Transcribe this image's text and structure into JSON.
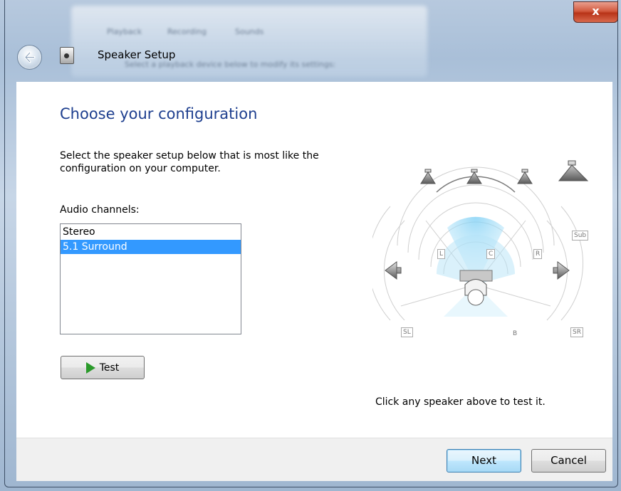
{
  "window": {
    "title": "Speaker Setup",
    "close_glyph": "x",
    "background_tabs": [
      "Playback",
      "Recording",
      "Sounds"
    ],
    "background_text": "Select a playback device below to modify its settings:"
  },
  "icons": {
    "back": "back-arrow-icon",
    "app": "speaker-setup-icon",
    "test": "play-icon"
  },
  "page": {
    "heading": "Choose your configuration",
    "description": "Select the speaker setup below that is most like the configuration on your computer.",
    "channels_label": "Audio channels:",
    "channels": [
      {
        "label": "Stereo",
        "selected": false
      },
      {
        "label": "5.1 Surround",
        "selected": true
      }
    ],
    "test_label": "Test",
    "hint": "Click any speaker above to test it."
  },
  "speakers": {
    "left": "L",
    "center": "C",
    "right": "R",
    "sub": "Sub",
    "surround_left": "SL",
    "surround_right": "SR",
    "listener_tag": "B"
  },
  "footer": {
    "next_label": "Next",
    "cancel_label": "Cancel"
  },
  "colors": {
    "heading": "#1e3f8f",
    "selection": "#3399ff",
    "play_icon": "#2a9a2a",
    "close_button": "#c8462b"
  }
}
